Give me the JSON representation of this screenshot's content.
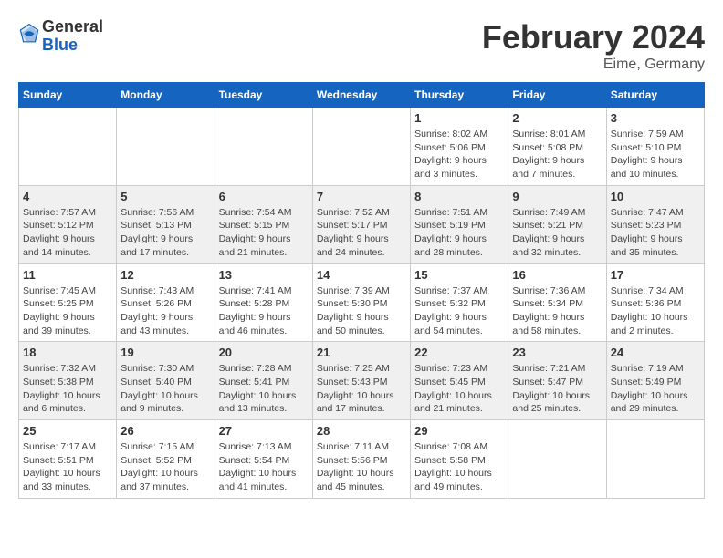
{
  "header": {
    "logo_general": "General",
    "logo_blue": "Blue",
    "month_title": "February 2024",
    "location": "Eime, Germany"
  },
  "weekdays": [
    "Sunday",
    "Monday",
    "Tuesday",
    "Wednesday",
    "Thursday",
    "Friday",
    "Saturday"
  ],
  "weeks": [
    [
      {
        "day": "",
        "sunrise": "",
        "sunset": "",
        "daylight": ""
      },
      {
        "day": "",
        "sunrise": "",
        "sunset": "",
        "daylight": ""
      },
      {
        "day": "",
        "sunrise": "",
        "sunset": "",
        "daylight": ""
      },
      {
        "day": "",
        "sunrise": "",
        "sunset": "",
        "daylight": ""
      },
      {
        "day": "1",
        "sunrise": "Sunrise: 8:02 AM",
        "sunset": "Sunset: 5:06 PM",
        "daylight": "Daylight: 9 hours and 3 minutes."
      },
      {
        "day": "2",
        "sunrise": "Sunrise: 8:01 AM",
        "sunset": "Sunset: 5:08 PM",
        "daylight": "Daylight: 9 hours and 7 minutes."
      },
      {
        "day": "3",
        "sunrise": "Sunrise: 7:59 AM",
        "sunset": "Sunset: 5:10 PM",
        "daylight": "Daylight: 9 hours and 10 minutes."
      }
    ],
    [
      {
        "day": "4",
        "sunrise": "Sunrise: 7:57 AM",
        "sunset": "Sunset: 5:12 PM",
        "daylight": "Daylight: 9 hours and 14 minutes."
      },
      {
        "day": "5",
        "sunrise": "Sunrise: 7:56 AM",
        "sunset": "Sunset: 5:13 PM",
        "daylight": "Daylight: 9 hours and 17 minutes."
      },
      {
        "day": "6",
        "sunrise": "Sunrise: 7:54 AM",
        "sunset": "Sunset: 5:15 PM",
        "daylight": "Daylight: 9 hours and 21 minutes."
      },
      {
        "day": "7",
        "sunrise": "Sunrise: 7:52 AM",
        "sunset": "Sunset: 5:17 PM",
        "daylight": "Daylight: 9 hours and 24 minutes."
      },
      {
        "day": "8",
        "sunrise": "Sunrise: 7:51 AM",
        "sunset": "Sunset: 5:19 PM",
        "daylight": "Daylight: 9 hours and 28 minutes."
      },
      {
        "day": "9",
        "sunrise": "Sunrise: 7:49 AM",
        "sunset": "Sunset: 5:21 PM",
        "daylight": "Daylight: 9 hours and 32 minutes."
      },
      {
        "day": "10",
        "sunrise": "Sunrise: 7:47 AM",
        "sunset": "Sunset: 5:23 PM",
        "daylight": "Daylight: 9 hours and 35 minutes."
      }
    ],
    [
      {
        "day": "11",
        "sunrise": "Sunrise: 7:45 AM",
        "sunset": "Sunset: 5:25 PM",
        "daylight": "Daylight: 9 hours and 39 minutes."
      },
      {
        "day": "12",
        "sunrise": "Sunrise: 7:43 AM",
        "sunset": "Sunset: 5:26 PM",
        "daylight": "Daylight: 9 hours and 43 minutes."
      },
      {
        "day": "13",
        "sunrise": "Sunrise: 7:41 AM",
        "sunset": "Sunset: 5:28 PM",
        "daylight": "Daylight: 9 hours and 46 minutes."
      },
      {
        "day": "14",
        "sunrise": "Sunrise: 7:39 AM",
        "sunset": "Sunset: 5:30 PM",
        "daylight": "Daylight: 9 hours and 50 minutes."
      },
      {
        "day": "15",
        "sunrise": "Sunrise: 7:37 AM",
        "sunset": "Sunset: 5:32 PM",
        "daylight": "Daylight: 9 hours and 54 minutes."
      },
      {
        "day": "16",
        "sunrise": "Sunrise: 7:36 AM",
        "sunset": "Sunset: 5:34 PM",
        "daylight": "Daylight: 9 hours and 58 minutes."
      },
      {
        "day": "17",
        "sunrise": "Sunrise: 7:34 AM",
        "sunset": "Sunset: 5:36 PM",
        "daylight": "Daylight: 10 hours and 2 minutes."
      }
    ],
    [
      {
        "day": "18",
        "sunrise": "Sunrise: 7:32 AM",
        "sunset": "Sunset: 5:38 PM",
        "daylight": "Daylight: 10 hours and 6 minutes."
      },
      {
        "day": "19",
        "sunrise": "Sunrise: 7:30 AM",
        "sunset": "Sunset: 5:40 PM",
        "daylight": "Daylight: 10 hours and 9 minutes."
      },
      {
        "day": "20",
        "sunrise": "Sunrise: 7:28 AM",
        "sunset": "Sunset: 5:41 PM",
        "daylight": "Daylight: 10 hours and 13 minutes."
      },
      {
        "day": "21",
        "sunrise": "Sunrise: 7:25 AM",
        "sunset": "Sunset: 5:43 PM",
        "daylight": "Daylight: 10 hours and 17 minutes."
      },
      {
        "day": "22",
        "sunrise": "Sunrise: 7:23 AM",
        "sunset": "Sunset: 5:45 PM",
        "daylight": "Daylight: 10 hours and 21 minutes."
      },
      {
        "day": "23",
        "sunrise": "Sunrise: 7:21 AM",
        "sunset": "Sunset: 5:47 PM",
        "daylight": "Daylight: 10 hours and 25 minutes."
      },
      {
        "day": "24",
        "sunrise": "Sunrise: 7:19 AM",
        "sunset": "Sunset: 5:49 PM",
        "daylight": "Daylight: 10 hours and 29 minutes."
      }
    ],
    [
      {
        "day": "25",
        "sunrise": "Sunrise: 7:17 AM",
        "sunset": "Sunset: 5:51 PM",
        "daylight": "Daylight: 10 hours and 33 minutes."
      },
      {
        "day": "26",
        "sunrise": "Sunrise: 7:15 AM",
        "sunset": "Sunset: 5:52 PM",
        "daylight": "Daylight: 10 hours and 37 minutes."
      },
      {
        "day": "27",
        "sunrise": "Sunrise: 7:13 AM",
        "sunset": "Sunset: 5:54 PM",
        "daylight": "Daylight: 10 hours and 41 minutes."
      },
      {
        "day": "28",
        "sunrise": "Sunrise: 7:11 AM",
        "sunset": "Sunset: 5:56 PM",
        "daylight": "Daylight: 10 hours and 45 minutes."
      },
      {
        "day": "29",
        "sunrise": "Sunrise: 7:08 AM",
        "sunset": "Sunset: 5:58 PM",
        "daylight": "Daylight: 10 hours and 49 minutes."
      },
      {
        "day": "",
        "sunrise": "",
        "sunset": "",
        "daylight": ""
      },
      {
        "day": "",
        "sunrise": "",
        "sunset": "",
        "daylight": ""
      }
    ]
  ]
}
